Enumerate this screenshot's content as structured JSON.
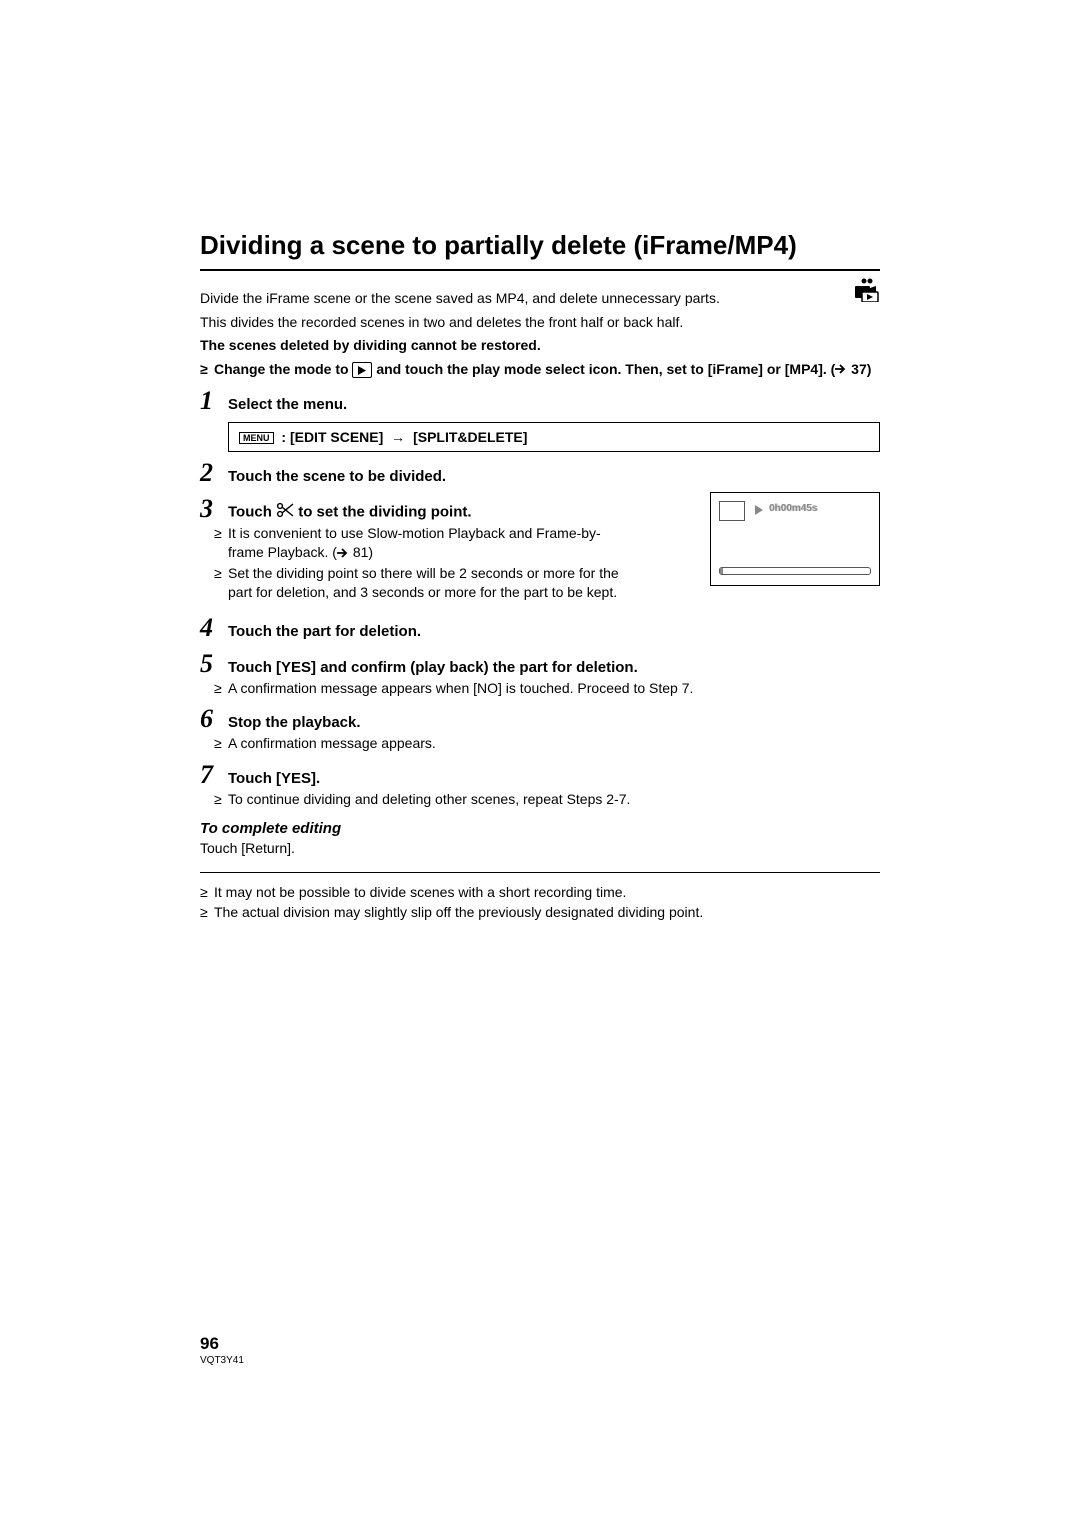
{
  "title": "Dividing a scene to partially delete (iFrame/MP4)",
  "intro": {
    "line1": "Divide the iFrame scene or the scene saved as MP4, and delete unnecessary parts.",
    "line2": "This divides the recorded scenes in two and deletes the front half or back half.",
    "warning": "The scenes deleted by dividing cannot be restored."
  },
  "prereq": {
    "textPre": "Change the mode to ",
    "textMid": " and touch the play mode select icon. Then, set to [iFrame] or [MP4]. (",
    "textPost": " 37)"
  },
  "menu": {
    "menuLabel": "MENU",
    "path1": ": [EDIT SCENE]",
    "path2": "[SPLIT&DELETE]"
  },
  "steps": {
    "s1": {
      "num": "1",
      "title": "Select the menu."
    },
    "s2": {
      "num": "2",
      "title": "Touch the scene to be divided."
    },
    "s3": {
      "num": "3",
      "titlePre": "Touch ",
      "titlePost": " to set the dividing point.",
      "sub1Pre": "It is convenient to use Slow-motion Playback and Frame-by-frame Playback. (",
      "sub1Post": " 81)",
      "sub2": "Set the dividing point so there will be 2 seconds or more for the part for deletion, and 3 seconds or more for the part to be kept."
    },
    "s4": {
      "num": "4",
      "title": "Touch the part for deletion."
    },
    "s5": {
      "num": "5",
      "title": "Touch [YES] and confirm (play back) the part for deletion.",
      "sub1": "A confirmation message appears when [NO] is touched. Proceed to Step 7."
    },
    "s6": {
      "num": "6",
      "title": "Stop the playback.",
      "sub1": "A confirmation message appears."
    },
    "s7": {
      "num": "7",
      "title": "Touch [YES].",
      "sub1": "To continue dividing and deleting other scenes, repeat Steps 2-7."
    }
  },
  "complete": {
    "title": "To complete editing",
    "body": "Touch [Return]."
  },
  "notes": {
    "n1": "It may not be possible to divide scenes with a short recording time.",
    "n2": "The actual division may slightly slip off the previously designated dividing point."
  },
  "preview": {
    "timestamp": "0h00m45s"
  },
  "footer": {
    "page": "96",
    "code": "VQT3Y41"
  }
}
